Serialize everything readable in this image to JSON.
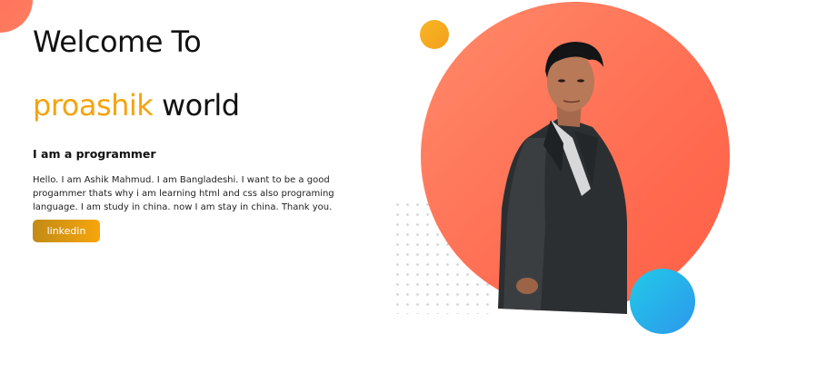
{
  "hero": {
    "title_line1": "Welcome To",
    "brand_word": "proashik",
    "brand_suffix": " world",
    "subtitle": "I am a programmer",
    "bio": "Hello. I am Ashik Mahmud. I am Bangladeshi. I want to be a good progammer thats why i am learning html and css also programing language. I am study in china. now I am stay in china. Thank you.",
    "linkedin_label": "linkedin"
  },
  "colors": {
    "brand": "#f5a30c",
    "circle": "#ff6d52",
    "accent_yellow": "#f7b626",
    "accent_blue": "#2d98ec"
  },
  "decor": {
    "corner_icon": "orange-quarter-circle",
    "portrait": "man-in-dark-suit-photo"
  }
}
